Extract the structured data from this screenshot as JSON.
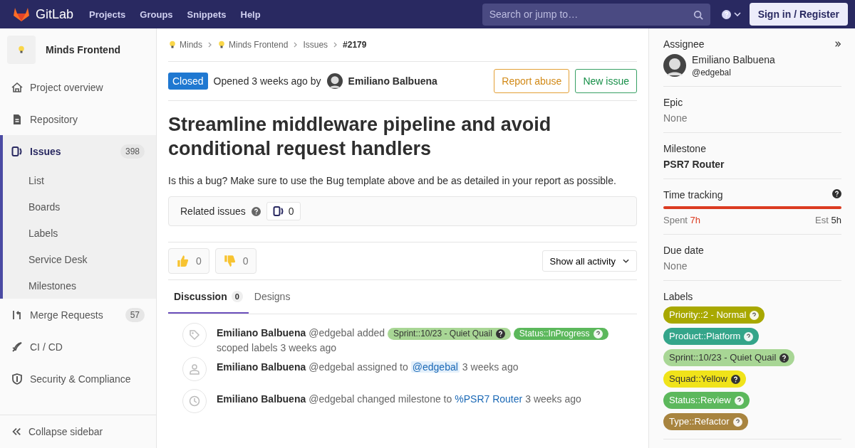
{
  "header": {
    "brand": "GitLab",
    "nav": [
      "Projects",
      "Groups",
      "Snippets",
      "Help"
    ],
    "search": {
      "placeholder": "Search or jump to…"
    },
    "sign_in": "Sign in / Register"
  },
  "sidebar": {
    "project": "Minds Frontend",
    "items": [
      {
        "kind": "overview",
        "label": "Project overview",
        "selected": false
      },
      {
        "kind": "repository",
        "label": "Repository",
        "selected": false
      },
      {
        "kind": "issues",
        "label": "Issues",
        "count": "398",
        "selected": true,
        "children": [
          {
            "label": "List",
            "selected": false
          },
          {
            "label": "Boards",
            "selected": false
          },
          {
            "label": "Labels",
            "selected": false
          },
          {
            "label": "Service Desk",
            "selected": false
          },
          {
            "label": "Milestones",
            "selected": false
          }
        ]
      },
      {
        "kind": "merge",
        "label": "Merge Requests",
        "count": "57",
        "selected": false
      },
      {
        "kind": "cicd",
        "label": "CI / CD",
        "selected": false
      },
      {
        "kind": "security",
        "label": "Security & Compliance",
        "selected": false
      }
    ],
    "collapse": "Collapse sidebar"
  },
  "breadcrumbs": [
    {
      "label": "Minds",
      "kind": "group"
    },
    {
      "label": "Minds Frontend",
      "kind": "group"
    },
    {
      "label": "Issues",
      "kind": "plain"
    },
    {
      "label": "#2179",
      "kind": "current"
    }
  ],
  "issue": {
    "status": "Closed",
    "opened": "Opened 3 weeks ago by",
    "author": "Emiliano Balbuena",
    "report": "Report abuse",
    "new_issue": "New issue",
    "title": "Streamline middleware pipeline and avoid conditional request handlers",
    "description": "Is this a bug? Make sure to use the Bug template above and be as detailed in your report as possible.",
    "related": {
      "label": "Related issues",
      "count": "0"
    },
    "reactions": [
      {
        "kind": "up",
        "count": "0"
      },
      {
        "kind": "down",
        "count": "0"
      }
    ],
    "activity_filter": "Show all activity",
    "tabs": [
      {
        "label": "Discussion",
        "count": "0",
        "selected": true
      },
      {
        "label": "Designs",
        "selected": false
      }
    ],
    "events": [
      {
        "kind": "label",
        "parts": [
          {
            "kind": "author",
            "text": "Emiliano Balbuena"
          },
          {
            "kind": "text",
            "text": "@edgebal added"
          },
          {
            "kind": "label",
            "text": "Sprint::10/23 - Quiet Quail",
            "color": "#a8d695"
          },
          {
            "kind": "label",
            "text": "Status::InProgress",
            "color": "#5cb85c"
          },
          {
            "kind": "text",
            "text": "scoped labels 3 weeks ago"
          }
        ]
      },
      {
        "kind": "user",
        "parts": [
          {
            "kind": "author",
            "text": "Emiliano Balbuena"
          },
          {
            "kind": "text",
            "text": "@edgebal assigned to"
          },
          {
            "kind": "mention",
            "text": "@edgebal"
          },
          {
            "kind": "text",
            "text": "3 weeks ago"
          }
        ]
      },
      {
        "kind": "clock",
        "parts": [
          {
            "kind": "author",
            "text": "Emiliano Balbuena"
          },
          {
            "kind": "text",
            "text": "@edgebal changed milestone to"
          },
          {
            "kind": "link",
            "text": "%PSR7 Router"
          },
          {
            "kind": "text",
            "text": "3 weeks ago"
          }
        ]
      }
    ]
  },
  "right": {
    "assignee": {
      "title": "Assignee",
      "name": "Emiliano Balbuena",
      "handle": "@edgebal"
    },
    "epic": {
      "title": "Epic",
      "value": "None"
    },
    "milestone": {
      "title": "Milestone",
      "value": "PSR7 Router"
    },
    "time": {
      "title": "Time tracking",
      "level": 1,
      "spent_label": "Spent",
      "spent": "7h",
      "est_label": "Est",
      "est": "5h"
    },
    "due": {
      "title": "Due date",
      "value": "None"
    },
    "labels": {
      "title": "Labels",
      "items": [
        {
          "text": "Priority::2 - Normal",
          "color": "#a8a800"
        },
        {
          "text": "Product::Platform",
          "color": "#34a58a"
        },
        {
          "text": "Sprint::10/23 - Quiet Quail",
          "color": "#a8d695"
        },
        {
          "text": "Squad::Yellow",
          "color": "#f0e31a"
        },
        {
          "text": "Status::Review",
          "color": "#5cb85c"
        },
        {
          "text": "Type::Refactor",
          "color": "#a8843f"
        }
      ]
    }
  }
}
